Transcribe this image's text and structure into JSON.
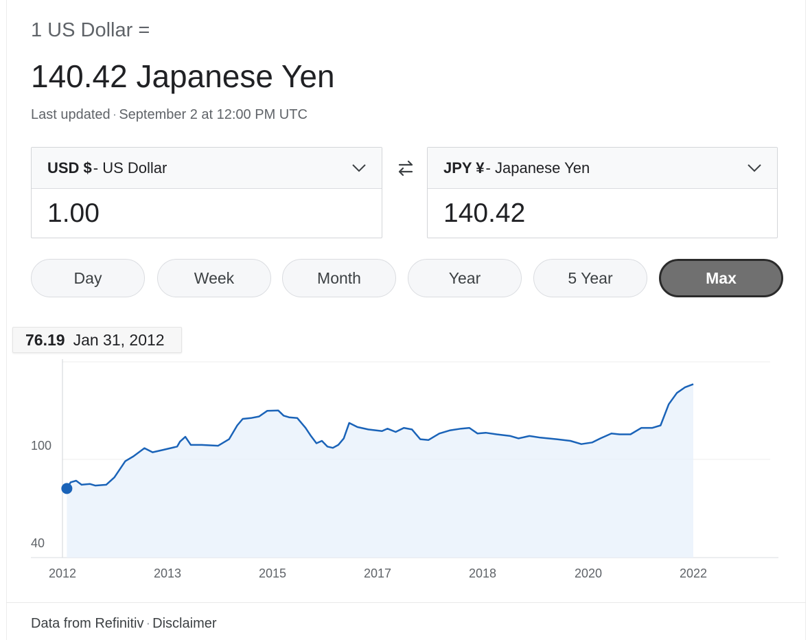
{
  "header": {
    "base_line": "1 US Dollar =",
    "result_line": "140.42 Japanese Yen",
    "updated_label": "Last updated",
    "updated_value": "September 2 at 12:00 PM UTC"
  },
  "converter": {
    "from": {
      "code": "USD $",
      "name": "- US Dollar",
      "value": "1.00"
    },
    "to": {
      "code": "JPY ¥",
      "name": "- Japanese Yen",
      "value": "140.42"
    }
  },
  "ranges": [
    "Day",
    "Week",
    "Month",
    "Year",
    "5 Year",
    "Max"
  ],
  "active_range": "Max",
  "tooltip": {
    "value": "76.19",
    "date": "Jan 31, 2012"
  },
  "footer": {
    "source": "Data from Refinitiv",
    "disclaimer": "Disclaimer"
  },
  "colors": {
    "line": "#1a63b8",
    "fill": "#e8f1fb",
    "active_button": "#707070"
  },
  "chart_data": {
    "type": "area",
    "title": "",
    "xlabel": "",
    "ylabel": "",
    "y_ticks": [
      "40",
      "100"
    ],
    "x_ticks": [
      "2012",
      "2013",
      "2015",
      "2017",
      "2018",
      "2020",
      "2022"
    ],
    "grid": true,
    "highlight": {
      "x": 2012.08,
      "y": 76.19
    },
    "series": [
      {
        "points": [
          [
            2012.08,
            76.19
          ],
          [
            2012.15,
            80
          ],
          [
            2012.25,
            81
          ],
          [
            2012.35,
            78.5
          ],
          [
            2012.5,
            79
          ],
          [
            2012.6,
            78
          ],
          [
            2012.8,
            78.5
          ],
          [
            2012.95,
            83
          ],
          [
            2013.15,
            93
          ],
          [
            2013.3,
            96
          ],
          [
            2013.5,
            101
          ],
          [
            2013.65,
            98.5
          ],
          [
            2013.85,
            100
          ],
          [
            2014.1,
            102
          ],
          [
            2014.15,
            105
          ],
          [
            2014.25,
            108
          ],
          [
            2014.35,
            103
          ],
          [
            2014.55,
            103
          ],
          [
            2014.85,
            102.5
          ],
          [
            2015.05,
            106.5
          ],
          [
            2015.2,
            115
          ],
          [
            2015.3,
            119
          ],
          [
            2015.45,
            119.5
          ],
          [
            2015.6,
            120.5
          ],
          [
            2015.75,
            124
          ],
          [
            2015.95,
            124.2
          ],
          [
            2016.05,
            121
          ],
          [
            2016.15,
            120
          ],
          [
            2016.3,
            119.5
          ],
          [
            2016.45,
            113.5
          ],
          [
            2016.55,
            108.5
          ],
          [
            2016.65,
            104
          ],
          [
            2016.75,
            105.5
          ],
          [
            2016.85,
            102
          ],
          [
            2016.95,
            101.2
          ],
          [
            2017.05,
            103
          ],
          [
            2017.15,
            107
          ],
          [
            2017.25,
            116.5
          ],
          [
            2017.4,
            114
          ],
          [
            2017.6,
            112.5
          ],
          [
            2017.85,
            111.5
          ],
          [
            2017.95,
            113
          ],
          [
            2018.1,
            111
          ],
          [
            2018.25,
            113.5
          ],
          [
            2018.4,
            112.5
          ],
          [
            2018.55,
            106.5
          ],
          [
            2018.7,
            106
          ],
          [
            2018.9,
            110
          ],
          [
            2019.1,
            112
          ],
          [
            2019.3,
            113
          ],
          [
            2019.45,
            113.5
          ],
          [
            2019.6,
            110
          ],
          [
            2019.75,
            110.5
          ],
          [
            2019.95,
            109.5
          ],
          [
            2020.2,
            108.5
          ],
          [
            2020.35,
            107
          ],
          [
            2020.55,
            108.5
          ],
          [
            2020.75,
            107.5
          ],
          [
            2021.05,
            106.5
          ],
          [
            2021.3,
            105.5
          ],
          [
            2021.5,
            103.5
          ],
          [
            2021.7,
            104.5
          ],
          [
            2021.85,
            107
          ],
          [
            2022.05,
            110
          ],
          [
            2022.2,
            109.5
          ],
          [
            2022.4,
            109.5
          ],
          [
            2022.6,
            113.5
          ],
          [
            2022.8,
            113.5
          ],
          [
            2022.95,
            115
          ],
          [
            2023.1,
            128
          ],
          [
            2023.25,
            135
          ],
          [
            2023.4,
            138.5
          ],
          [
            2023.55,
            140.4
          ]
        ]
      }
    ]
  }
}
